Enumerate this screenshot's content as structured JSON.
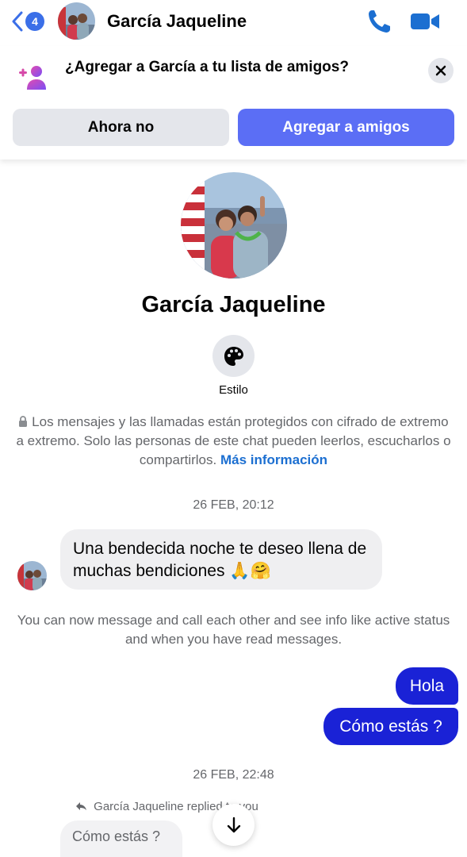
{
  "header": {
    "back_count": "4",
    "title": "García Jaqueline"
  },
  "banner": {
    "text": "¿Agregar a García a tu lista de amigos?",
    "dismiss_label": "Ahora no",
    "add_label": "Agregar a amigos"
  },
  "profile": {
    "name": "García Jaqueline",
    "style_label": "Estilo"
  },
  "encryption": {
    "notice": "Los mensajes y las llamadas están protegidos con cifrado de extremo a extremo. Solo las personas de este chat pueden leerlos, escucharlos o compartirlos.",
    "link": "Más información"
  },
  "messages": {
    "date_1": "26 FEB, 20:12",
    "incoming_text": "Una bendecida noche te deseo llena de muchas bendiciones",
    "incoming_emoji": "🙏🤗",
    "info_notice": "You can now message and call each other and see info like active status and when you have read messages.",
    "outgoing_1": "Hola",
    "outgoing_2": "Cómo estás ?",
    "date_2": "26 FEB, 22:48",
    "reply_label": "García Jaqueline replied to you",
    "reply_quote": "Cómo estás ?"
  },
  "colors": {
    "accent": "#3b6fe8",
    "add_button": "#5b6ef5",
    "outgoing_bubble": "#1a22d6",
    "incoming_bubble": "#efeff1"
  }
}
